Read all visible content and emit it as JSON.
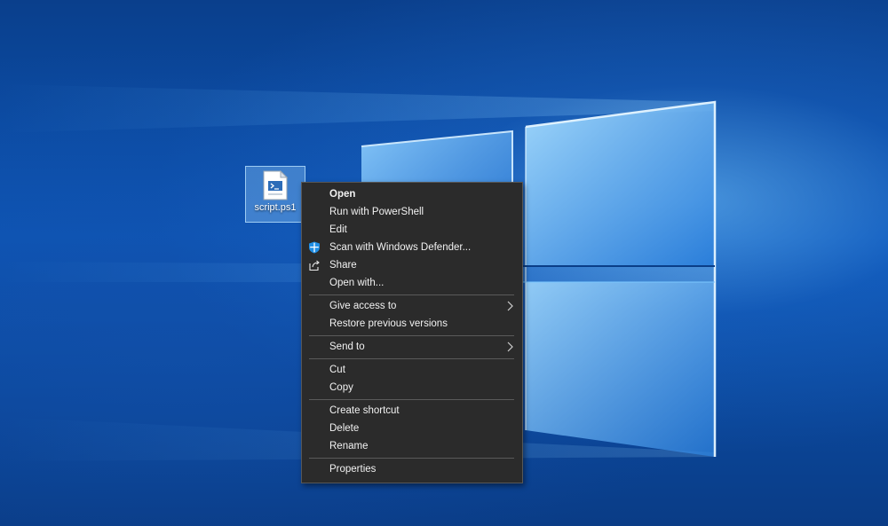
{
  "desktop": {
    "file": {
      "name": "script.ps1",
      "icon": "powershell-file-icon"
    }
  },
  "context_menu": {
    "groups": [
      [
        {
          "label": "Open",
          "bold": true
        },
        {
          "label": "Run with PowerShell"
        },
        {
          "label": "Edit"
        },
        {
          "label": "Scan with Windows Defender...",
          "icon": "windows-defender-shield-icon"
        },
        {
          "label": "Share",
          "icon": "share-icon"
        },
        {
          "label": "Open with..."
        }
      ],
      [
        {
          "label": "Give access to",
          "submenu": true
        },
        {
          "label": "Restore previous versions"
        }
      ],
      [
        {
          "label": "Send to",
          "submenu": true
        }
      ],
      [
        {
          "label": "Cut"
        },
        {
          "label": "Copy"
        }
      ],
      [
        {
          "label": "Create shortcut"
        },
        {
          "label": "Delete"
        },
        {
          "label": "Rename"
        }
      ],
      [
        {
          "label": "Properties"
        }
      ]
    ]
  },
  "colors": {
    "menu_background": "#2b2b2b",
    "menu_text": "#f2f2f2",
    "separator": "#5a5a5a",
    "defender_blue": "#1f8fe6"
  }
}
